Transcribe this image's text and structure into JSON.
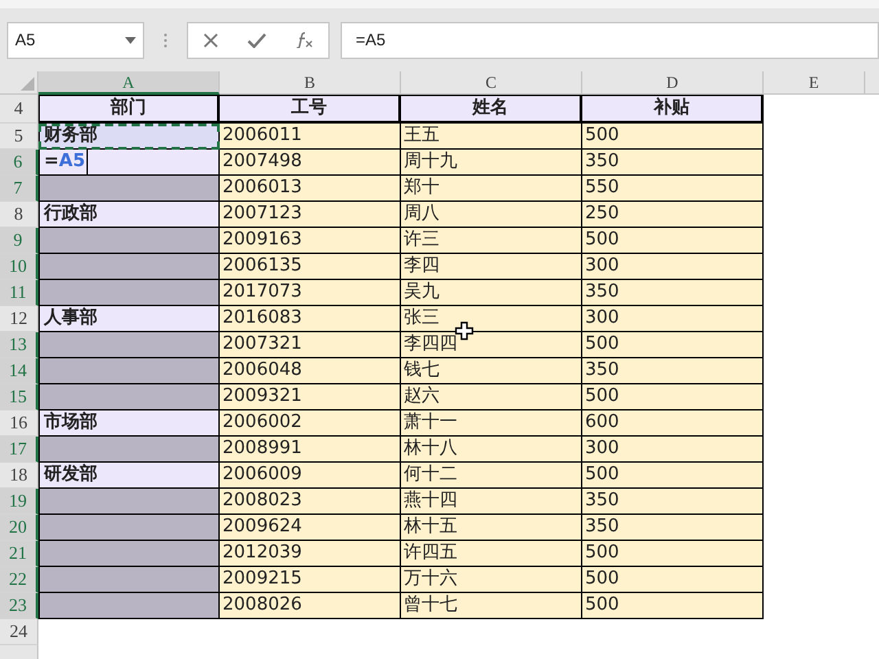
{
  "name_box": {
    "value": "A5"
  },
  "formula_bar": {
    "value": "=A5"
  },
  "columns": [
    {
      "label": "A",
      "selected": true
    },
    {
      "label": "B",
      "selected": false
    },
    {
      "label": "C",
      "selected": false
    },
    {
      "label": "D",
      "selected": false
    },
    {
      "label": "E",
      "selected": false
    }
  ],
  "header_row": {
    "number": "4",
    "selected": false,
    "cells": [
      "部门",
      "工号",
      "姓名",
      "补贴"
    ]
  },
  "rows": [
    {
      "number": "5",
      "selected": false,
      "dept": {
        "kind": "copy_source",
        "text": "财务部"
      },
      "id": "2006011",
      "name": "王五",
      "allowance": "500"
    },
    {
      "number": "6",
      "selected": true,
      "dept": {
        "kind": "editing",
        "prefix": "=",
        "ref": "A5"
      },
      "id": "2007498",
      "name": "周十九",
      "allowance": "350"
    },
    {
      "number": "7",
      "selected": true,
      "dept": {
        "kind": "blank"
      },
      "id": "2006013",
      "name": "郑十",
      "allowance": "550"
    },
    {
      "number": "8",
      "selected": false,
      "dept": {
        "kind": "label",
        "text": "行政部"
      },
      "id": "2007123",
      "name": "周八",
      "allowance": "250"
    },
    {
      "number": "9",
      "selected": true,
      "dept": {
        "kind": "blank"
      },
      "id": "2009163",
      "name": "许三",
      "allowance": "500"
    },
    {
      "number": "10",
      "selected": true,
      "dept": {
        "kind": "blank"
      },
      "id": "2006135",
      "name": "李四",
      "allowance": "300"
    },
    {
      "number": "11",
      "selected": true,
      "dept": {
        "kind": "blank"
      },
      "id": "2017073",
      "name": "吴九",
      "allowance": "350"
    },
    {
      "number": "12",
      "selected": false,
      "dept": {
        "kind": "label",
        "text": "人事部"
      },
      "id": "2016083",
      "name": "张三",
      "allowance": "300"
    },
    {
      "number": "13",
      "selected": true,
      "dept": {
        "kind": "blank"
      },
      "id": "2007321",
      "name": "李四四",
      "allowance": "500"
    },
    {
      "number": "14",
      "selected": true,
      "dept": {
        "kind": "blank"
      },
      "id": "2006048",
      "name": "钱七",
      "allowance": "350"
    },
    {
      "number": "15",
      "selected": true,
      "dept": {
        "kind": "blank"
      },
      "id": "2009321",
      "name": "赵六",
      "allowance": "500"
    },
    {
      "number": "16",
      "selected": false,
      "dept": {
        "kind": "label",
        "text": "市场部"
      },
      "id": "2006002",
      "name": "萧十一",
      "allowance": "600"
    },
    {
      "number": "17",
      "selected": true,
      "dept": {
        "kind": "blank"
      },
      "id": "2008991",
      "name": "林十八",
      "allowance": "300"
    },
    {
      "number": "18",
      "selected": false,
      "dept": {
        "kind": "label",
        "text": "研发部"
      },
      "id": "2006009",
      "name": "何十二",
      "allowance": "500"
    },
    {
      "number": "19",
      "selected": true,
      "dept": {
        "kind": "blank"
      },
      "id": "2008023",
      "name": "燕十四",
      "allowance": "350"
    },
    {
      "number": "20",
      "selected": true,
      "dept": {
        "kind": "blank"
      },
      "id": "2009624",
      "name": "林十五",
      "allowance": "350"
    },
    {
      "number": "21",
      "selected": true,
      "dept": {
        "kind": "blank"
      },
      "id": "2012039",
      "name": "许四五",
      "allowance": "500"
    },
    {
      "number": "22",
      "selected": true,
      "dept": {
        "kind": "blank"
      },
      "id": "2009215",
      "name": "万十六",
      "allowance": "500"
    },
    {
      "number": "23",
      "selected": true,
      "dept": {
        "kind": "blank"
      },
      "id": "2008026",
      "name": "曾十七",
      "allowance": "500"
    }
  ],
  "empty_rows": [
    {
      "number": "24",
      "selected": false
    }
  ]
}
